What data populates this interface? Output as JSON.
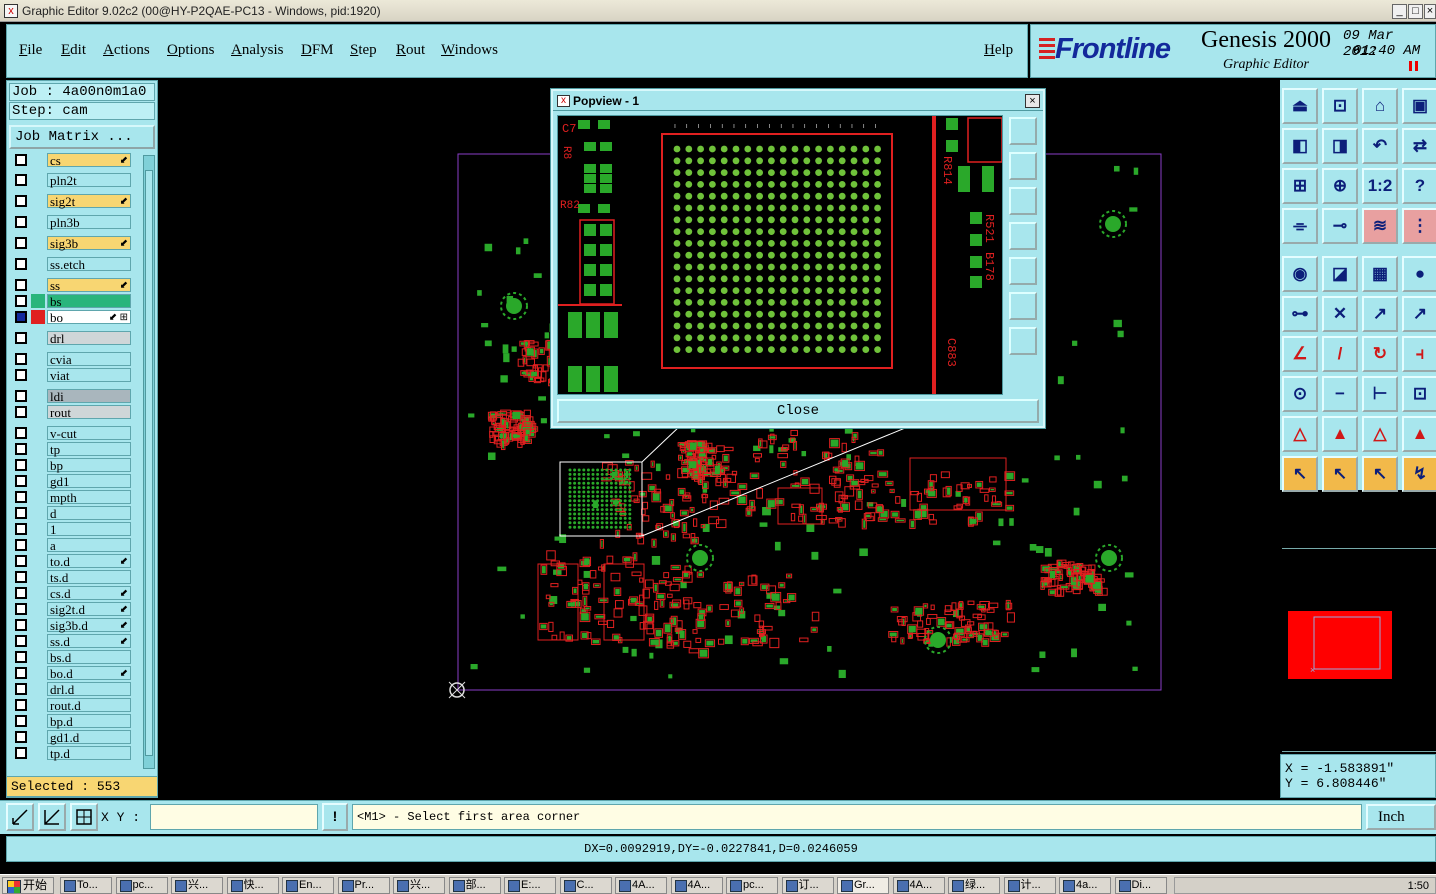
{
  "window": {
    "title": "Graphic Editor 9.02c2 (00@HY-P2QAE-PC13 - Windows, pid:1920)",
    "app_icon": "x",
    "min": "_",
    "max": "□",
    "close": "×"
  },
  "menu": [
    "File",
    "Edit",
    "Actions",
    "Options",
    "Analysis",
    "DFM",
    "Step",
    "Rout",
    "Windows"
  ],
  "help": "Help",
  "logo": {
    "brand": "Frontline",
    "product": "Genesis 2000",
    "subtitle": "Graphic Editor",
    "date": "09 Mar 2012",
    "time": "01:40 AM",
    "brand_color": "#13299b"
  },
  "job": {
    "job_line": "Job : 4a00n0m1a0",
    "step_line": "Step: cam",
    "matrix_button": "Job Matrix ..."
  },
  "layers": [
    {
      "name": "cs",
      "style": "sig",
      "mark": "⬋"
    },
    {
      "name": "pln2t",
      "style": "",
      "mark": ""
    },
    {
      "name": "sig2t",
      "style": "sig",
      "mark": "⬋"
    },
    {
      "name": "pln3b",
      "style": "",
      "mark": ""
    },
    {
      "name": "sig3b",
      "style": "sig",
      "mark": "⬋"
    },
    {
      "name": "ss.etch",
      "style": "",
      "mark": ""
    },
    {
      "name": "ss",
      "style": "sig",
      "mark": "⬋"
    },
    {
      "name": "bs",
      "style": "bs",
      "mark": ""
    },
    {
      "name": "bo",
      "style": "bo",
      "mark": "⬋ ⊞"
    },
    {
      "name": "drl",
      "style": "grey",
      "mark": ""
    },
    {
      "name": "cvia",
      "style": "",
      "mark": ""
    },
    {
      "name": "viat",
      "style": "",
      "mark": ""
    },
    {
      "name": "ldi",
      "style": "greyb",
      "mark": ""
    },
    {
      "name": "rout",
      "style": "grey",
      "mark": ""
    },
    {
      "name": "v-cut",
      "style": "",
      "mark": ""
    },
    {
      "name": "tp",
      "style": "",
      "mark": ""
    },
    {
      "name": "bp",
      "style": "",
      "mark": ""
    },
    {
      "name": "gd1",
      "style": "",
      "mark": ""
    },
    {
      "name": "mpth",
      "style": "",
      "mark": ""
    },
    {
      "name": "d",
      "style": "",
      "mark": ""
    },
    {
      "name": "1",
      "style": "",
      "mark": ""
    },
    {
      "name": "a",
      "style": "",
      "mark": ""
    },
    {
      "name": "to.d",
      "style": "",
      "mark": "⬋"
    },
    {
      "name": "ts.d",
      "style": "",
      "mark": ""
    },
    {
      "name": "cs.d",
      "style": "",
      "mark": "⬋"
    },
    {
      "name": "sig2t.d",
      "style": "",
      "mark": "⬋"
    },
    {
      "name": "sig3b.d",
      "style": "",
      "mark": "⬋"
    },
    {
      "name": "ss.d",
      "style": "",
      "mark": "⬋"
    },
    {
      "name": "bs.d",
      "style": "",
      "mark": ""
    },
    {
      "name": "bo.d",
      "style": "",
      "mark": "⬋"
    },
    {
      "name": "drl.d",
      "style": "",
      "mark": ""
    },
    {
      "name": "rout.d",
      "style": "",
      "mark": ""
    },
    {
      "name": "bp.d",
      "style": "",
      "mark": ""
    },
    {
      "name": "gd1.d",
      "style": "",
      "mark": ""
    },
    {
      "name": "tp.d",
      "style": "",
      "mark": ""
    }
  ],
  "selected": "Selected : 553",
  "popview": {
    "title": "Popview - 1",
    "close_label": "Close",
    "labels": [
      "C7",
      "R82",
      "R814",
      "R521",
      "B178",
      "C883",
      "R8"
    ]
  },
  "coords": {
    "x": "X = -1.583891\"",
    "y": "Y = 6.808446\""
  },
  "bottom": {
    "xy_label": "X Y :",
    "xy_value": "",
    "bang": "!",
    "prompt": "<M1> - Select first area corner",
    "unit": "Inch"
  },
  "status": "DX=0.0092919,DY=-0.0227841,D=0.0246059",
  "taskbar": {
    "start": "开始",
    "tasks": [
      "To...",
      "pc...",
      "兴...",
      "快...",
      "En...",
      "Pr...",
      "兴...",
      "部...",
      "E:...",
      "C...",
      "4A...",
      "4A...",
      "pc...",
      "订...",
      "Gr...",
      "4A...",
      "绿...",
      "计...",
      "4a...",
      "Di..."
    ],
    "clock": "1:50"
  },
  "colors": {
    "panel": "#a8e6ed",
    "signal_layer": "#f8d672",
    "copper": "#e02020",
    "pad": "#2aa82a",
    "profile": "#8a3ec8"
  }
}
